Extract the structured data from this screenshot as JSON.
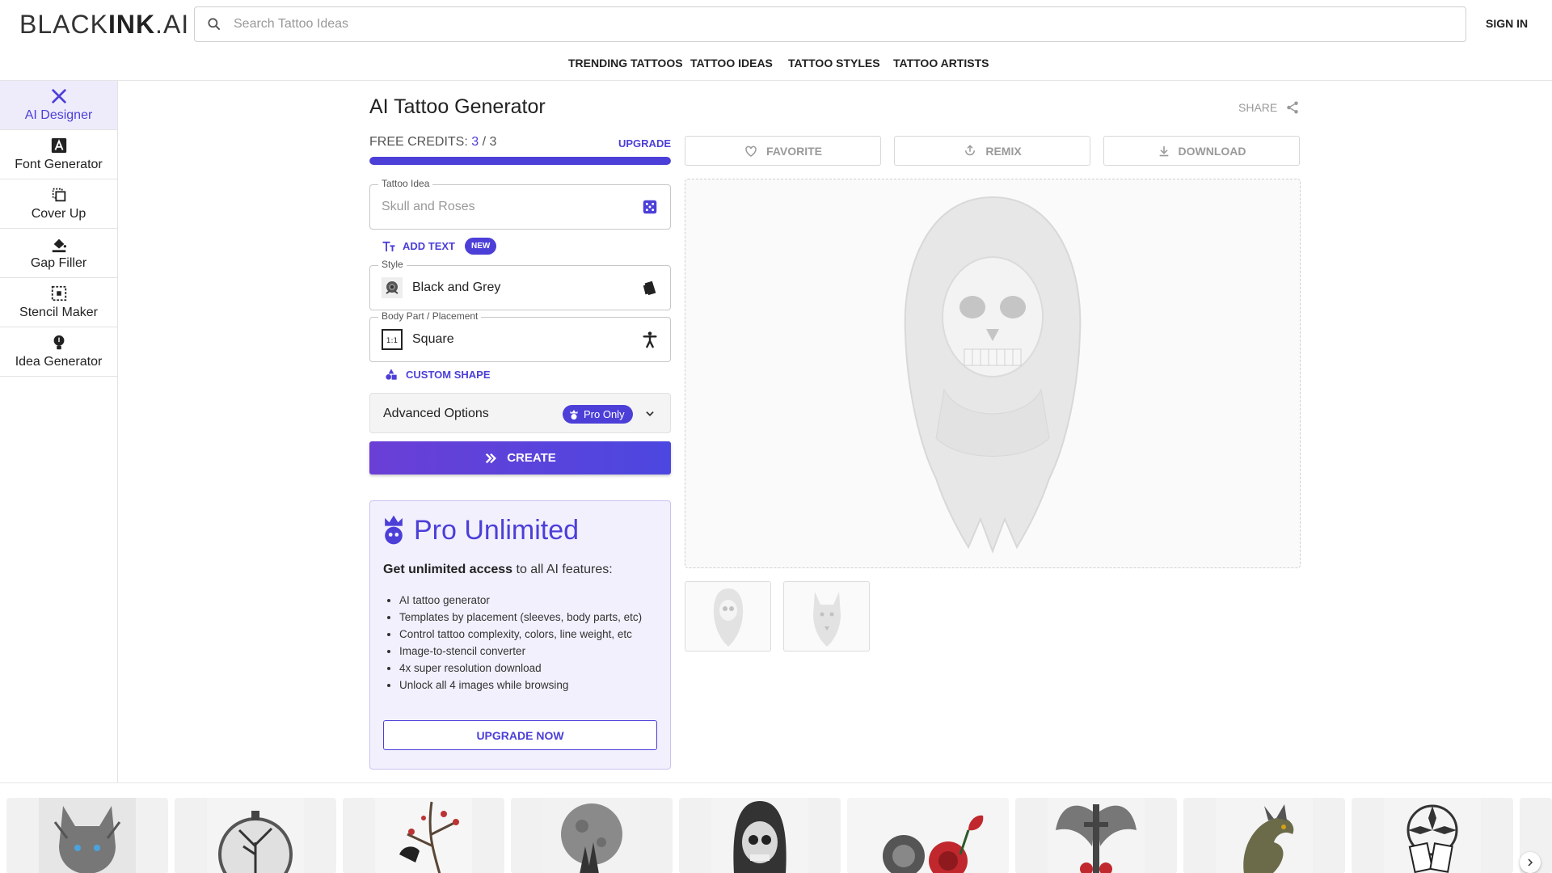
{
  "header": {
    "logo_prefix": "BLACK",
    "logo_bold": "INK",
    "logo_suffix": ".AI",
    "search_placeholder": "Search Tattoo Ideas",
    "signin_label": "SIGN IN",
    "nav": [
      "TRENDING TATTOOS",
      "TATTOO IDEAS",
      "TATTOO STYLES",
      "TATTOO ARTISTS"
    ]
  },
  "sidebar": {
    "items": [
      {
        "label": "AI Designer",
        "icon": "brush-pencil-icon",
        "active": true
      },
      {
        "label": "Font Generator",
        "icon": "font-a-icon",
        "active": false
      },
      {
        "label": "Cover Up",
        "icon": "cover-up-icon",
        "active": false
      },
      {
        "label": "Gap Filler",
        "icon": "paint-bucket-icon",
        "active": false
      },
      {
        "label": "Stencil Maker",
        "icon": "stencil-select-icon",
        "active": false
      },
      {
        "label": "Idea Generator",
        "icon": "lightbulb-icon",
        "active": false
      }
    ]
  },
  "main": {
    "title": "AI Tattoo Generator",
    "share_label": "SHARE",
    "credits_label": "FREE CREDITS:",
    "credits_used": "3",
    "credits_sep": " / ",
    "credits_total": "3",
    "credits_fraction": 1.0,
    "upgrade_label": "UPGRADE",
    "tattoo_idea": {
      "legend": "Tattoo Idea",
      "placeholder": "Skull and Roses"
    },
    "add_text": {
      "label": "ADD TEXT",
      "badge": "NEW"
    },
    "style": {
      "legend": "Style",
      "value": "Black and Grey"
    },
    "placement": {
      "legend": "Body Part / Placement",
      "value": "Square",
      "ratio": "1:1"
    },
    "custom_shape_label": "CUSTOM SHAPE",
    "advanced": {
      "label": "Advanced Options",
      "badge": "Pro Only"
    },
    "create_label": "CREATE",
    "pro_card": {
      "title": "Pro Unlimited",
      "sub_bold": "Get unlimited access",
      "sub_rest": " to all AI features:",
      "features": [
        "AI tattoo generator",
        "Templates by placement (sleeves, body parts, etc)",
        "Control tattoo complexity, colors, line weight, etc",
        "Image-to-stencil converter",
        "4x super resolution download",
        "Unlock all 4 images while browsing"
      ],
      "cta": "UPGRADE NOW"
    }
  },
  "preview": {
    "actions": [
      "FAVORITE",
      "REMIX",
      "DOWNLOAD"
    ],
    "thumbnails": [
      "hooded-skull",
      "wolf"
    ]
  },
  "gallery": {
    "items": [
      "wolf",
      "clock-tree",
      "raven-branch",
      "moon-forest",
      "hooded-skull",
      "skull-roses",
      "winged-sword",
      "dragon",
      "cards-mandala"
    ]
  },
  "colors": {
    "accent": "#4c3fd8",
    "active_bg": "#eeecfb",
    "pro_bg": "#f2f0fd"
  }
}
